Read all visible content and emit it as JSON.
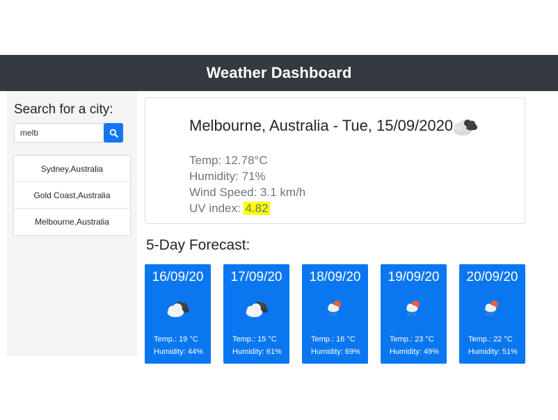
{
  "header": {
    "title": "Weather Dashboard"
  },
  "sidebar": {
    "heading": "Search for a city:",
    "search": {
      "value": "melb",
      "placeholder": ""
    },
    "search_icon": "search-icon",
    "cities": [
      "Sydney,Australia",
      "Gold Coast,Australia",
      "Melbourne,Australia"
    ]
  },
  "current": {
    "title": "Melbourne, Australia - Tue, 15/09/2020",
    "icon": "cloud-broken-icon",
    "temp": "Temp: 12.78°C",
    "humidity": "Humidity: 71%",
    "wind": "Wind Speed: 3.1 km/h",
    "uv_label": "UV index:",
    "uv_value": "4.82",
    "uv_color": "#ffff00"
  },
  "forecast": {
    "heading": "5-Day Forecast:",
    "accent": "#0a77f0",
    "days": [
      {
        "date": "16/09/20",
        "icon": "cloud-broken-icon",
        "temp": "Temp.: 19 °C",
        "humidity": "Humidity: 44%"
      },
      {
        "date": "17/09/20",
        "icon": "cloud-broken-icon",
        "temp": "Temp.: 15 °C",
        "humidity": "Humidity: 61%"
      },
      {
        "date": "18/09/20",
        "icon": "rain-sun-icon",
        "temp": "Temp.: 16 °C",
        "humidity": "Humidity: 69%"
      },
      {
        "date": "19/09/20",
        "icon": "rain-sun-icon",
        "temp": "Temp.: 23 °C",
        "humidity": "Humidity: 49%"
      },
      {
        "date": "20/09/20",
        "icon": "rain-sun-icon",
        "temp": "Temp.: 22 °C",
        "humidity": "Humidity: 51%"
      }
    ]
  }
}
